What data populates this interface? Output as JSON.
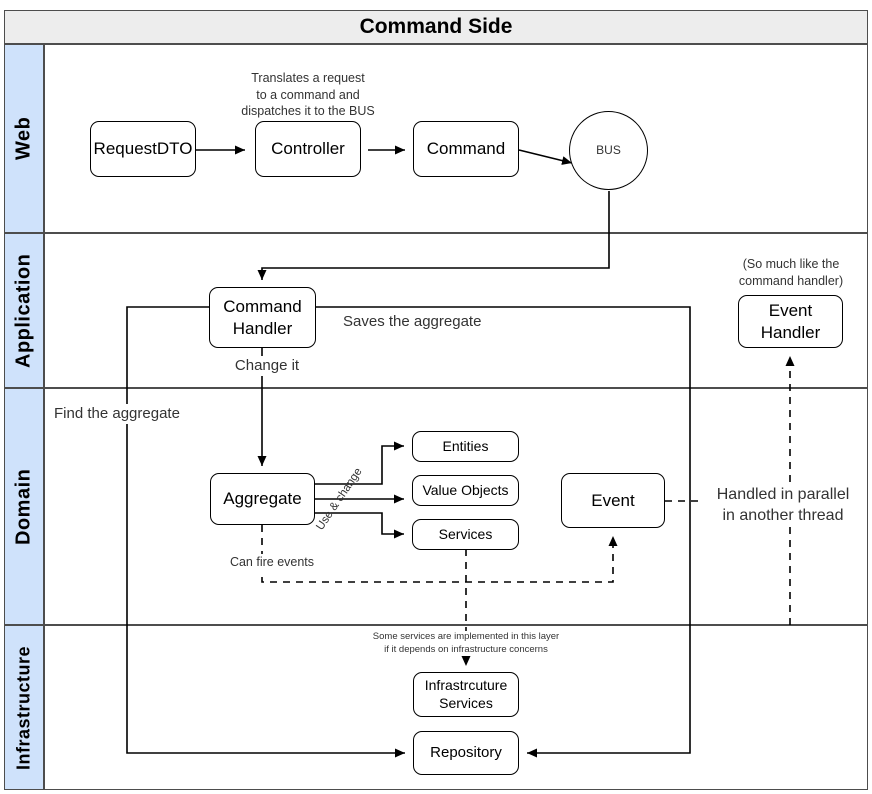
{
  "header": {
    "title": "Command Side",
    "bg": "#ededed",
    "border": "#4d4d4d"
  },
  "theme": {
    "band_bg": "#cfe2fb",
    "band_border": "#4d4d4d",
    "line": "#000000",
    "label_color": "#333333",
    "node_bg": "#ffffff",
    "node_border": "#000000"
  },
  "bands": [
    {
      "name": "web",
      "label": "Web"
    },
    {
      "name": "application",
      "label": "Application"
    },
    {
      "name": "domain",
      "label": "Domain"
    },
    {
      "name": "infrastructure",
      "label": "Infrastructure"
    }
  ],
  "nodes": {
    "request_dto": {
      "label": "RequestDTO"
    },
    "controller": {
      "label": "Controller"
    },
    "command": {
      "label": "Command"
    },
    "bus": {
      "label": "BUS"
    },
    "command_handler": {
      "label": "Command\nHandler"
    },
    "event_handler": {
      "label": "Event\nHandler"
    },
    "aggregate": {
      "label": "Aggregate"
    },
    "entities": {
      "label": "Entities"
    },
    "value_objects": {
      "label": "Value Objects"
    },
    "services": {
      "label": "Services"
    },
    "event": {
      "label": "Event"
    },
    "infrastructure_services": {
      "label": "Infrastrcuture\nServices"
    },
    "repository": {
      "label": "Repository"
    }
  },
  "annotations": {
    "translates": "Translates a request\nto a command and\ndispatches it to the BUS",
    "so_much_like": "(So much like the\ncommand handler)",
    "saves_aggregate": "Saves the aggregate",
    "change_it": "Change it",
    "find_aggregate": "Find the aggregate",
    "use_and_change": "Use & change",
    "can_fire_events": "Can fire events",
    "handled_parallel": "Handled in parallel\nin another thread",
    "some_services": "Some services are implemented in this layer\nif it depends on infrastructure concerns"
  }
}
